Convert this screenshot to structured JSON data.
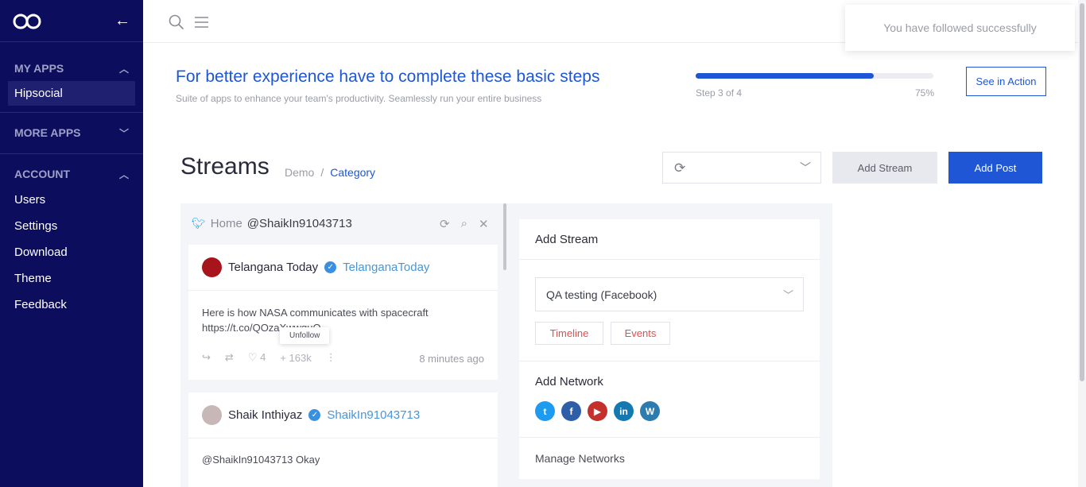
{
  "sidebar": {
    "sections": [
      {
        "title": "MY APPS",
        "items": [
          "Hipsocial"
        ]
      },
      {
        "title": "MORE APPS",
        "items": []
      },
      {
        "title": "ACCOUNT",
        "items": [
          "Users",
          "Settings",
          "Download",
          "Theme",
          "Feedback"
        ]
      }
    ]
  },
  "toast": {
    "message": "You have followed successfully"
  },
  "onboarding": {
    "title": "For better experience have to complete these basic steps",
    "subtitle": "Suite of apps to enhance your team's productivity. Seamlessly run your entire business",
    "step_label": "Step 3 of 4",
    "percent_label": "75%",
    "progress": 0.75,
    "see_action_label": "See in Action"
  },
  "page": {
    "title": "Streams",
    "breadcrumb": [
      "Demo",
      "Category"
    ],
    "add_stream_label": "Add Stream",
    "add_post_label": "Add Post"
  },
  "stream": {
    "column_label": "Home",
    "account": "@ShaikIn91043713",
    "posts": [
      {
        "name": "Telangana Today",
        "handle": "TelanganaToday",
        "text": "Here is how NASA communicates with spacecraft https://t.co/QOzaXwwguQ",
        "likes": "4",
        "follows": "163k",
        "time": "8 minutes ago",
        "tooltip": "Unfollow"
      },
      {
        "name": "Shaik Inthiyaz",
        "handle": "ShaikIn91043713",
        "text": "@ShaikIn91043713 Okay"
      }
    ]
  },
  "add_stream_panel": {
    "title": "Add Stream",
    "account_select": "QA testing (Facebook)",
    "tabs": [
      "Timeline",
      "Events"
    ],
    "add_network_title": "Add Network",
    "networks": [
      "twitter-icon",
      "facebook-icon",
      "youtube-icon",
      "linkedin-icon",
      "wordpress-icon"
    ],
    "manage_networks": "Manage Networks"
  },
  "colors": {
    "sidebar": "#0c0d5c",
    "accent": "#1e56d6",
    "danger": "#d9534f"
  }
}
